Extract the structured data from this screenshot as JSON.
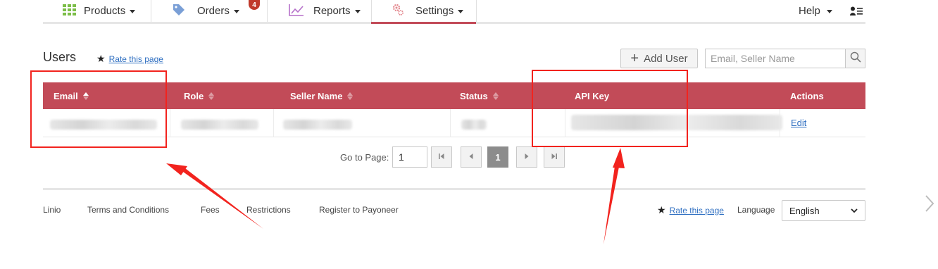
{
  "nav": {
    "items": [
      {
        "label": "Products",
        "icon": "grid-icon"
      },
      {
        "label": "Orders",
        "icon": "tag-icon",
        "badge": "4"
      },
      {
        "label": "Reports",
        "icon": "chart-icon"
      },
      {
        "label": "Settings",
        "icon": "gear-icon",
        "active": true
      }
    ],
    "help_label": "Help",
    "user_icon": "user-menu-icon"
  },
  "page": {
    "title": "Users",
    "rate_label": "Rate this page"
  },
  "toolbar": {
    "add_user_label": "Add User",
    "search_placeholder": "Email, Seller Name"
  },
  "table": {
    "headers": [
      "Email",
      "Role",
      "Seller Name",
      "Status",
      "API Key",
      "Actions"
    ],
    "rows": [
      {
        "action_label": "Edit"
      }
    ]
  },
  "pager": {
    "goto_label": "Go to Page:",
    "goto_value": "1",
    "current_page": "1"
  },
  "footer": {
    "links": [
      "Linio",
      "Terms and Conditions",
      "Fees",
      "Restrictions",
      "Register to Payoneer"
    ],
    "rate_label": "Rate this page",
    "language_label": "Language",
    "language_value": "English"
  },
  "colors": {
    "accent": "#c24b58",
    "link": "#2f6fc1",
    "annotation": "#f2231e"
  }
}
